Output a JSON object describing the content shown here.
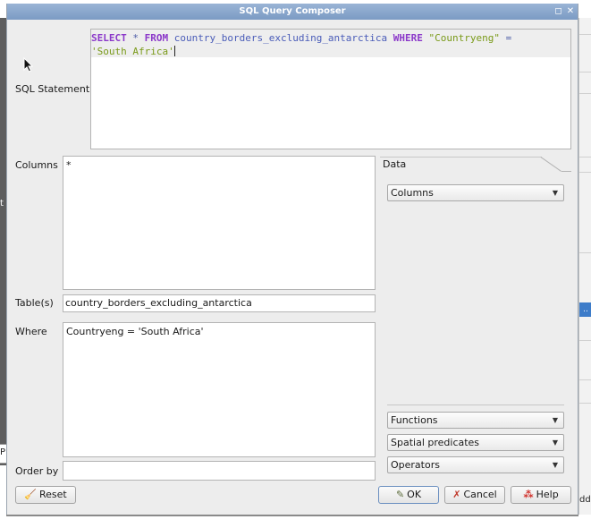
{
  "window": {
    "title": "SQL Query Composer",
    "controls": [
      "◻",
      "✕"
    ]
  },
  "sql": {
    "label": "SQL Statement",
    "keyword_select": "SELECT",
    "star": "*",
    "keyword_from": "FROM",
    "table": "country_borders_excluding_antarctica",
    "keyword_where": "WHERE",
    "field": "\"Countryeng\"",
    "operator": "=",
    "value": "'South Africa'"
  },
  "columns": {
    "label": "Columns",
    "value": "*"
  },
  "tables": {
    "label": "Table(s)",
    "value": "country_borders_excluding_antarctica"
  },
  "where": {
    "label": "Where",
    "value": "Countryeng = 'South Africa'"
  },
  "orderby": {
    "label": "Order by",
    "value": ""
  },
  "data_panel": {
    "tab": "Data",
    "columns_combo": "Columns",
    "functions_combo": "Functions",
    "spatial_combo": "Spatial predicates",
    "operators_combo": "Operators"
  },
  "buttons": {
    "reset": "Reset",
    "ok": "OK",
    "cancel": "Cancel",
    "help": "Help"
  },
  "background": {
    "left_glyph": "t",
    "left_glyph2": "P",
    "right_selected": "..",
    "right_text": "dd"
  }
}
